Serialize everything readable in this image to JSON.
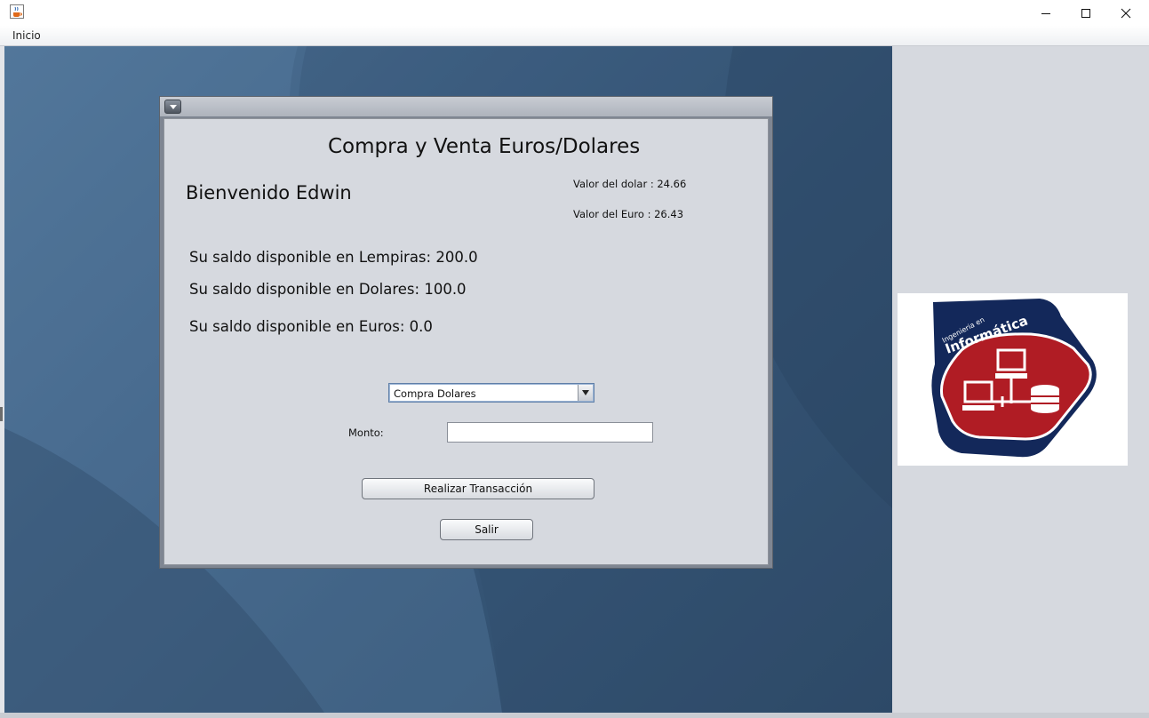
{
  "window": {
    "icon": "java-cup-icon",
    "controls": [
      "minimize-icon",
      "maximize-icon",
      "close-icon"
    ]
  },
  "menubar": {
    "items": [
      {
        "label": "Inicio"
      }
    ]
  },
  "internal_frame": {
    "title": "Compra y Venta Euros/Dolares",
    "welcome": "Bienvenido Edwin",
    "rates": {
      "dollar": "Valor del dolar : 24.66",
      "euro": "Valor del Euro : 26.43"
    },
    "balances": {
      "lempiras": "Su saldo disponible en Lempiras: 200.0",
      "dolares": "Su saldo disponible en Dolares: 100.0",
      "euros": "Su saldo disponible en Euros: 0.0"
    },
    "operation_select": {
      "selected": "Compra Dolares"
    },
    "amount": {
      "label": "Monto:",
      "value": ""
    },
    "buttons": {
      "transaction": "Realizar Transacción",
      "exit": "Salir"
    }
  },
  "logo": {
    "subtitle": "Ingenieria en",
    "title": "Informática",
    "colors": {
      "navy": "#13285a",
      "red": "#b01c24",
      "white": "#ffffff"
    }
  },
  "colors": {
    "desktop": "#3f6184",
    "panel": "#d6d9df"
  }
}
